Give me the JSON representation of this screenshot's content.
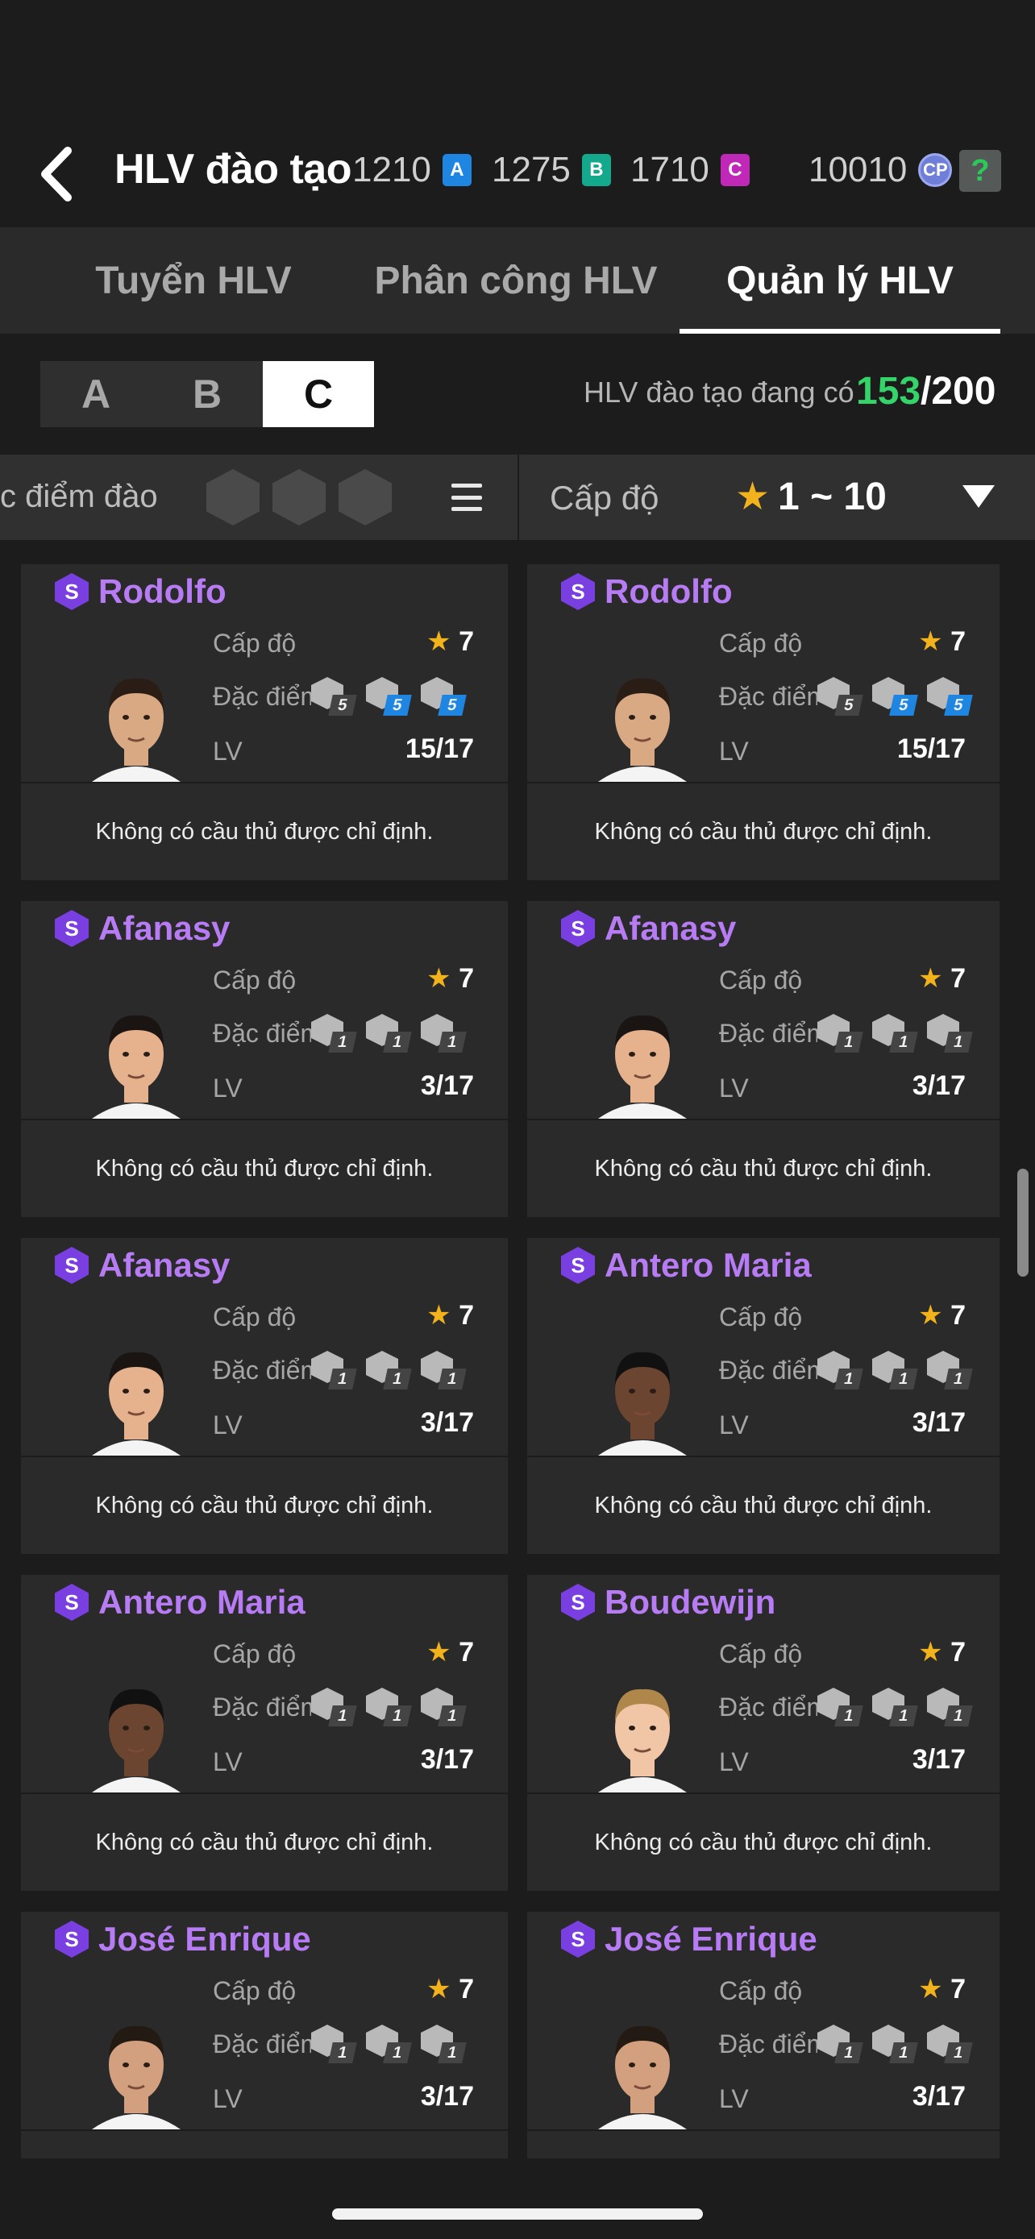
{
  "header": {
    "title": "HLV đào tạo",
    "currencies": [
      {
        "value": "1210",
        "letter": "A",
        "color": "#1e86e0"
      },
      {
        "value": "1275",
        "letter": "B",
        "color": "#14a88c"
      },
      {
        "value": "1710",
        "letter": "C",
        "color": "#c028b8"
      }
    ],
    "cp_value": "10010",
    "cp_label": "CP",
    "help_label": "?"
  },
  "tabs": [
    {
      "label": "Tuyển HLV"
    },
    {
      "label": "Phân công HLV"
    },
    {
      "label": "Quản lý HLV"
    }
  ],
  "groups": {
    "items": [
      "A",
      "B",
      "C"
    ],
    "active": "C",
    "count_label": "HLV đào tạo đang có",
    "count_current": "153",
    "count_max": "/200"
  },
  "filter": {
    "trait_label": "c điểm đào",
    "level_label": "Cấp độ",
    "level_range": "1 ~ 10"
  },
  "card_labels": {
    "grade": "Cấp độ",
    "trait": "Đặc điểm",
    "lv": "LV",
    "empty": "Không có cầu thủ được chỉ định."
  },
  "coaches": [
    {
      "name": "Rodolfo",
      "grade": "7",
      "lv": "15/17",
      "traits": [
        {
          "icon": "trait-icon",
          "n": "5",
          "blue": false
        },
        {
          "icon": "trait-icon",
          "n": "5",
          "blue": true
        },
        {
          "icon": "trait-icon",
          "n": "5",
          "blue": true
        }
      ]
    },
    {
      "name": "Rodolfo",
      "grade": "7",
      "lv": "15/17",
      "traits": [
        {
          "icon": "trait-icon",
          "n": "5",
          "blue": false
        },
        {
          "icon": "trait-icon",
          "n": "5",
          "blue": true
        },
        {
          "icon": "trait-icon",
          "n": "5",
          "blue": true
        }
      ]
    },
    {
      "name": "Afanasy",
      "grade": "7",
      "lv": "3/17",
      "traits": [
        {
          "icon": "trait-icon",
          "n": "1",
          "blue": false
        },
        {
          "icon": "trait-icon",
          "n": "1",
          "blue": false
        },
        {
          "icon": "trait-icon",
          "n": "1",
          "blue": false
        }
      ]
    },
    {
      "name": "Afanasy",
      "grade": "7",
      "lv": "3/17",
      "traits": [
        {
          "icon": "trait-icon",
          "n": "1",
          "blue": false
        },
        {
          "icon": "trait-icon",
          "n": "1",
          "blue": false
        },
        {
          "icon": "trait-icon",
          "n": "1",
          "blue": false
        }
      ]
    },
    {
      "name": "Afanasy",
      "grade": "7",
      "lv": "3/17",
      "traits": [
        {
          "icon": "trait-icon",
          "n": "1",
          "blue": false
        },
        {
          "icon": "trait-icon",
          "n": "1",
          "blue": false
        },
        {
          "icon": "trait-icon",
          "n": "1",
          "blue": false
        }
      ]
    },
    {
      "name": "Antero Maria",
      "grade": "7",
      "lv": "3/17",
      "traits": [
        {
          "icon": "trait-icon",
          "n": "1",
          "blue": false
        },
        {
          "icon": "trait-icon",
          "n": "1",
          "blue": false
        },
        {
          "icon": "trait-icon",
          "n": "1",
          "blue": false
        }
      ]
    },
    {
      "name": "Antero Maria",
      "grade": "7",
      "lv": "3/17",
      "traits": [
        {
          "icon": "trait-icon",
          "n": "1",
          "blue": false
        },
        {
          "icon": "trait-icon",
          "n": "1",
          "blue": false
        },
        {
          "icon": "trait-icon",
          "n": "1",
          "blue": false
        }
      ]
    },
    {
      "name": "Boudewijn",
      "grade": "7",
      "lv": "3/17",
      "traits": [
        {
          "icon": "trait-icon",
          "n": "1",
          "blue": false
        },
        {
          "icon": "trait-icon",
          "n": "1",
          "blue": false
        },
        {
          "icon": "trait-icon",
          "n": "1",
          "blue": false
        }
      ]
    },
    {
      "name": "José Enrique",
      "grade": "7",
      "lv": "3/17",
      "traits": [
        {
          "icon": "trait-icon",
          "n": "1",
          "blue": false
        },
        {
          "icon": "trait-icon",
          "n": "1",
          "blue": false
        },
        {
          "icon": "trait-icon",
          "n": "1",
          "blue": false
        }
      ]
    },
    {
      "name": "José Enrique",
      "grade": "7",
      "lv": "3/17",
      "traits": [
        {
          "icon": "trait-icon",
          "n": "1",
          "blue": false
        },
        {
          "icon": "trait-icon",
          "n": "1",
          "blue": false
        },
        {
          "icon": "trait-icon",
          "n": "1",
          "blue": false
        }
      ]
    }
  ],
  "colors": {
    "accent_green": "#35d46a",
    "name_purple": "#b77cf3",
    "star_gold": "#f2b21b",
    "bg": "#1c1c1d",
    "card_bg": "#2a2a2b"
  }
}
